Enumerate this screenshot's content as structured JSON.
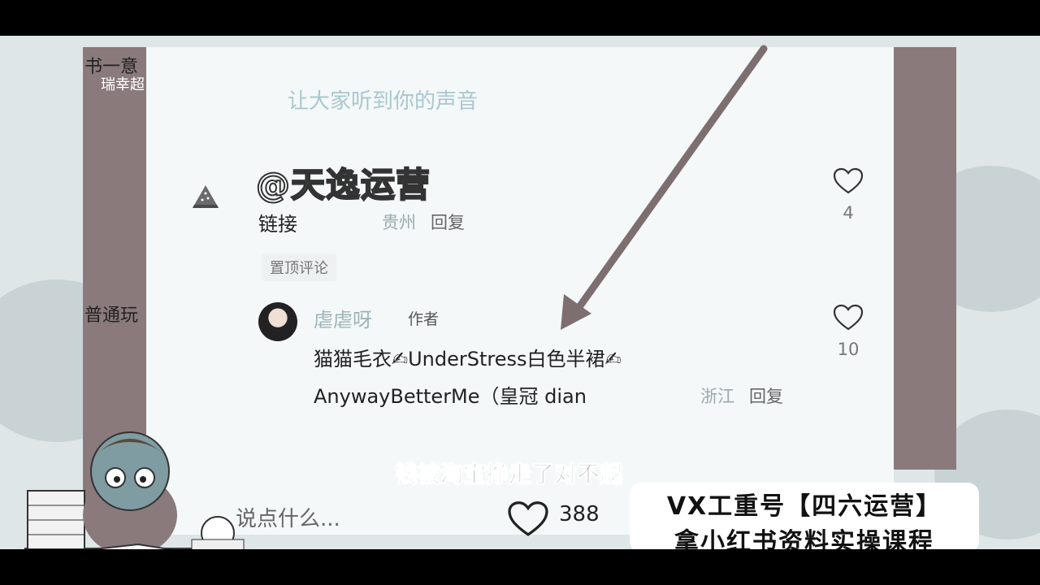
{
  "background": {
    "left_snippets": [
      "书一意",
      "瑞幸超",
      "普通玩"
    ]
  },
  "comment_input_hint": "让大家听到你的声音",
  "watermark": "@天逸运营",
  "comment1": {
    "text": "链接",
    "location": "贵州",
    "reply_label": "回复",
    "likes": "4"
  },
  "pinned_tag": "置顶评论",
  "comment2": {
    "author": "虐虐呀",
    "author_tag": "作者",
    "line1": "猫猫毛衣✍UnderStress白色半裙✍",
    "line2": "AnywayBetterMe（皇冠 dian",
    "location": "浙江",
    "reply_label": "回复",
    "likes": "10"
  },
  "bottom_bar": {
    "placeholder": "说点什么...",
    "like_count": "388"
  },
  "subtitle": "钱被淘宝挣走了对不起",
  "promo": {
    "line1": "VX工重号【四六运营】",
    "line2": "拿小红书资料实操课程"
  },
  "colors": {
    "panel": "#8a7a7c",
    "arrow": "#7d6e70",
    "hint": "#a9c7cf"
  }
}
